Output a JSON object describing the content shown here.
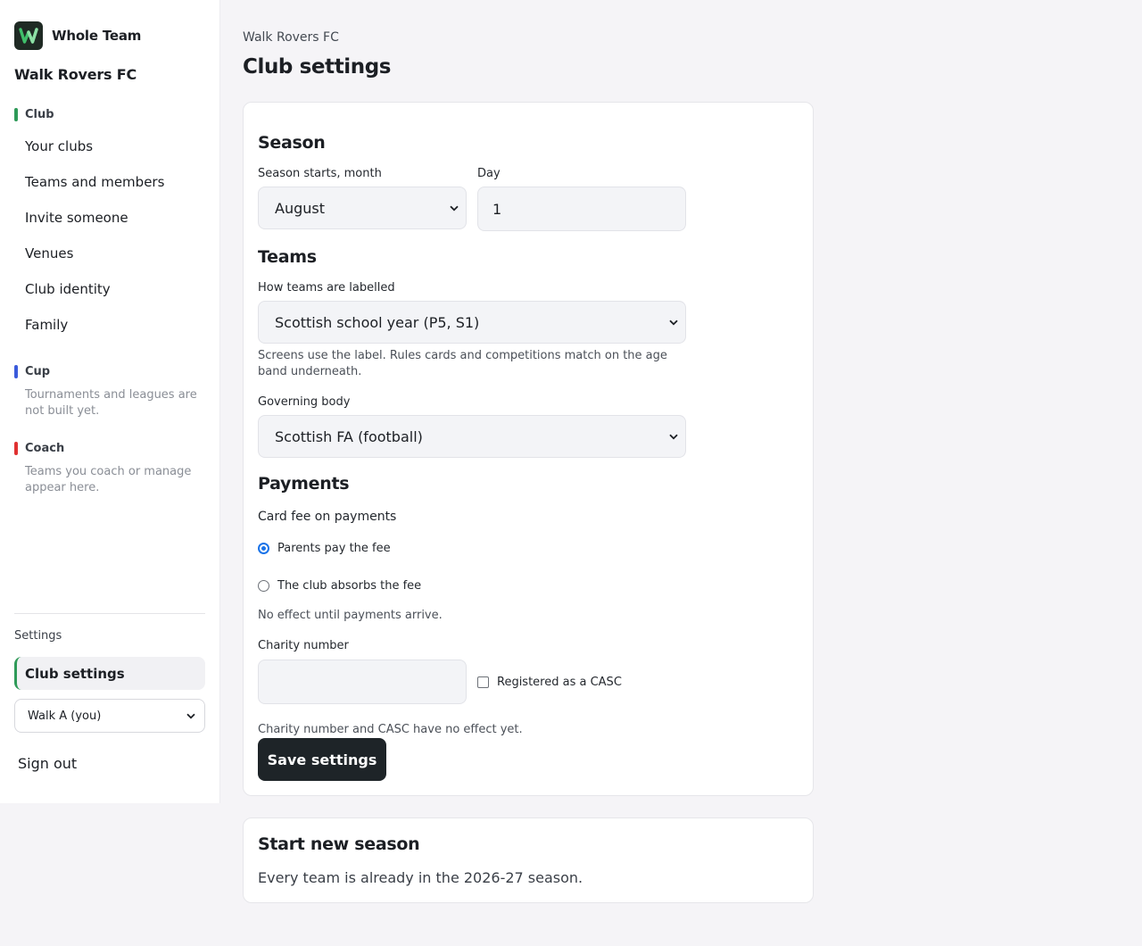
{
  "brand": {
    "name": "Whole Team",
    "logo_icon": "whole-team-logo-icon"
  },
  "sidebar": {
    "club_name": "Walk Rovers FC",
    "sections": {
      "club": {
        "label": "Club",
        "color": "#2e9a58",
        "items": [
          "Your clubs",
          "Teams and members",
          "Invite someone",
          "Venues",
          "Club identity",
          "Family"
        ]
      },
      "cup": {
        "label": "Cup",
        "color": "#3b5bdb",
        "note": "Tournaments and leagues are not built yet."
      },
      "coach": {
        "label": "Coach",
        "color": "#e03131",
        "note": "Teams you coach or manage appear here."
      }
    },
    "settings_label": "Settings",
    "active_item": "Club settings",
    "user_select": "Walk A (you)",
    "sign_out": "Sign out"
  },
  "header": {
    "breadcrumb": "Walk Rovers FC",
    "title": "Club settings"
  },
  "form": {
    "season": {
      "heading": "Season",
      "month_label": "Season starts, month",
      "month_value": "August",
      "day_label": "Day",
      "day_value": "1"
    },
    "teams": {
      "heading": "Teams",
      "labelling_label": "How teams are labelled",
      "labelling_value": "Scottish school year (P5, S1)",
      "labelling_help": "Screens use the label. Rules cards and competitions match on the age band underneath.",
      "governing_label": "Governing body",
      "governing_value": "Scottish FA (football)"
    },
    "payments": {
      "heading": "Payments",
      "card_fee_label": "Card fee on payments",
      "option_parents": "Parents pay the fee",
      "option_club": "The club absorbs the fee",
      "selected": "Parents pay the fee",
      "payments_help": "No effect until payments arrive.",
      "charity_label": "Charity number",
      "charity_value": "",
      "casc_label": "Registered as a CASC",
      "casc_checked": false,
      "charity_help": "Charity number and CASC have no effect yet."
    },
    "save_label": "Save settings"
  },
  "new_season": {
    "heading": "Start new season",
    "text": "Every team is already in the 2026-27 season."
  }
}
